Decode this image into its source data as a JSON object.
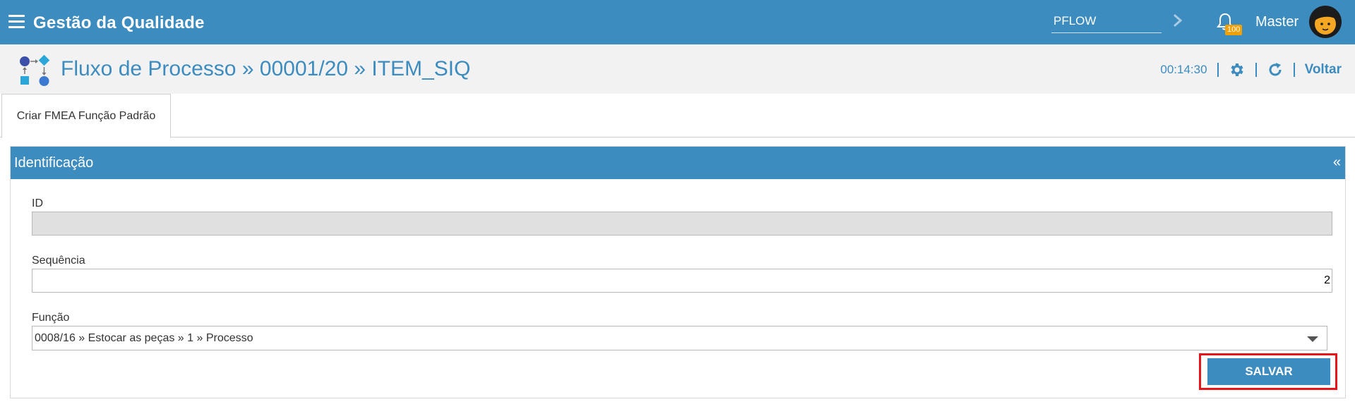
{
  "topbar": {
    "app_title": "Gestão da Qualidade",
    "search_value": "PFLOW",
    "notification_count": "100",
    "user_name": "Master"
  },
  "header": {
    "breadcrumb": "Fluxo de Processo » 00001/20 » ITEM_SIQ",
    "timer": "00:14:30",
    "back_label": "Voltar"
  },
  "tabs": [
    {
      "label": "Criar FMEA Função Padrão",
      "active": true
    }
  ],
  "panel": {
    "title": "Identificação",
    "collapse_symbol": "«",
    "fields": {
      "id_label": "ID",
      "id_value": "",
      "sequence_label": "Sequência",
      "sequence_value": "2",
      "function_label": "Função",
      "function_value": "0008/16 » Estocar as peças » 1 » Processo"
    },
    "save_label": "SALVAR"
  },
  "colors": {
    "primary": "#3d8cbf",
    "badge": "#f0a000",
    "highlight": "#e8141c"
  },
  "icons": [
    "hamburger-icon",
    "chevron-right-icon",
    "bell-icon",
    "avatar-icon",
    "process-flow-icon",
    "gear-icon",
    "refresh-icon",
    "chevron-down-icon"
  ]
}
